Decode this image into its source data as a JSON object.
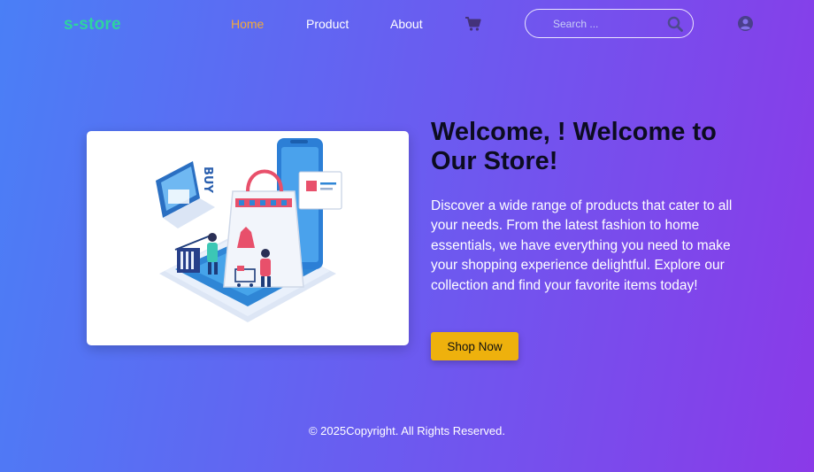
{
  "brand": {
    "logo_text": "s-store",
    "logo_color": "#2ed3a0"
  },
  "nav": {
    "links": [
      {
        "label": "Home",
        "active": true
      },
      {
        "label": "Product",
        "active": false
      },
      {
        "label": "About",
        "active": false
      }
    ],
    "cart_icon": "shopping-cart-icon",
    "search": {
      "placeholder": "Search ...",
      "value": "",
      "icon": "magnifier-icon"
    },
    "user_icon": "user-circle-icon"
  },
  "hero": {
    "image_alt_icon": "online-shopping-illustration",
    "image_text": "BUY",
    "title": "Welcome, ! Welcome to Our Store!",
    "description": "Discover a wide range of products that cater to all your needs. From the latest fashion to home essentials, we have everything you need to make your shopping experience delightful. Explore our collection and find your favorite items today!",
    "cta_label": "Shop Now"
  },
  "footer": {
    "text": "© 2025Copyright. All Rights Reserved."
  },
  "colors": {
    "gradient_start": "#4a7ff6",
    "gradient_end": "#8a3ae8",
    "active_link": "#f2a93b",
    "cta": "#eeb10d",
    "title": "#0c0c20"
  }
}
